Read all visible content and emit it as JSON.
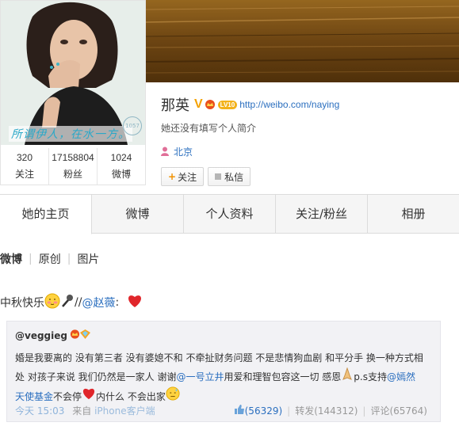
{
  "avatar": {
    "tagline": "所谓伊人，在水一方。",
    "seal": "1057"
  },
  "stats": [
    {
      "value": "320",
      "label": "关注"
    },
    {
      "value": "17158804",
      "label": "粉丝"
    },
    {
      "value": "1024",
      "label": "微博"
    }
  ],
  "profile": {
    "name": "那英",
    "verified": "V",
    "level": "LV10",
    "url": "http://weibo.com/naying",
    "bio": "她还没有填写个人简介",
    "location": "北京",
    "follow_label": "关注",
    "message_label": "私信"
  },
  "tabs": [
    "她的主页",
    "微博",
    "个人资料",
    "关注/粉丝",
    "相册"
  ],
  "subtabs": [
    "微博",
    "原创",
    "图片"
  ],
  "post": {
    "text_prefix": "中秋快乐",
    "separator": " //",
    "mention": "@赵薇",
    "colon": ":"
  },
  "repost": {
    "user": "@veggieg",
    "line1": "婚是我要离的 没有第三者 没有婆媳不和 不牵扯财务问题 不是悲情狗血剧 和平分手 换一种方式相",
    "line2_prefix": "处 对孩子来说 我们仍然是一家人 谢谢",
    "line2_mention": "@一号立井",
    "line2_mid": " 用爱和理智包容这一切 感恩",
    "line2_ps": " p.s支持",
    "line2_mention2": "@嫣然",
    "line3_mention": "天使基金",
    "line3_a": " 不会停",
    "line3_b": " 内什么 不会出家",
    "time": "今天 15:03",
    "from_label": "来自",
    "source": "iPhone客户端",
    "likes": "(56329)",
    "forward": "转发(144312)",
    "comment": "评论(65764)"
  },
  "colors": {
    "link": "#2b6fbf",
    "accent_orange": "#f29100",
    "heart": "#e0262b"
  }
}
